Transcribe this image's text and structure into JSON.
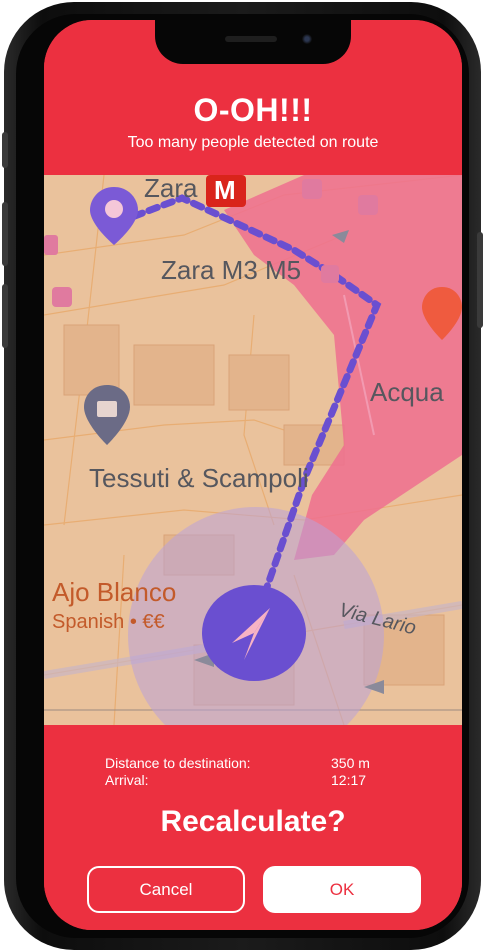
{
  "alert": {
    "title": "O-OH!!!",
    "subtitle": "Too many people detected on route"
  },
  "map": {
    "labels": {
      "zara": "Zara",
      "metro_letter": "M",
      "zara_station": "Zara M3 M5",
      "acqua": "Acqua",
      "tessuti": "Tessuti & Scampoli",
      "ajo_blanco": "Ajo Blanco",
      "ajo_cuisine": "Spanish • €€",
      "via_lario": "Via Lario"
    },
    "colors": {
      "route": "#6a4fd0",
      "crowd_zone": "#ef6f8f",
      "base": "#eac29c",
      "poi_pin": "#6b6b86",
      "restaurant_pin": "#ef5b3f",
      "metro": "#d9241b"
    }
  },
  "route_info": {
    "distance_label": "Distance to destination:",
    "distance_value": "350 m",
    "arrival_label": "Arrival:",
    "arrival_value": "12:17"
  },
  "prompt": {
    "question": "Recalculate?",
    "cancel_label": "Cancel",
    "ok_label": "OK"
  },
  "theme": {
    "accent": "#ec3040",
    "text_on_accent": "#ffffff"
  }
}
